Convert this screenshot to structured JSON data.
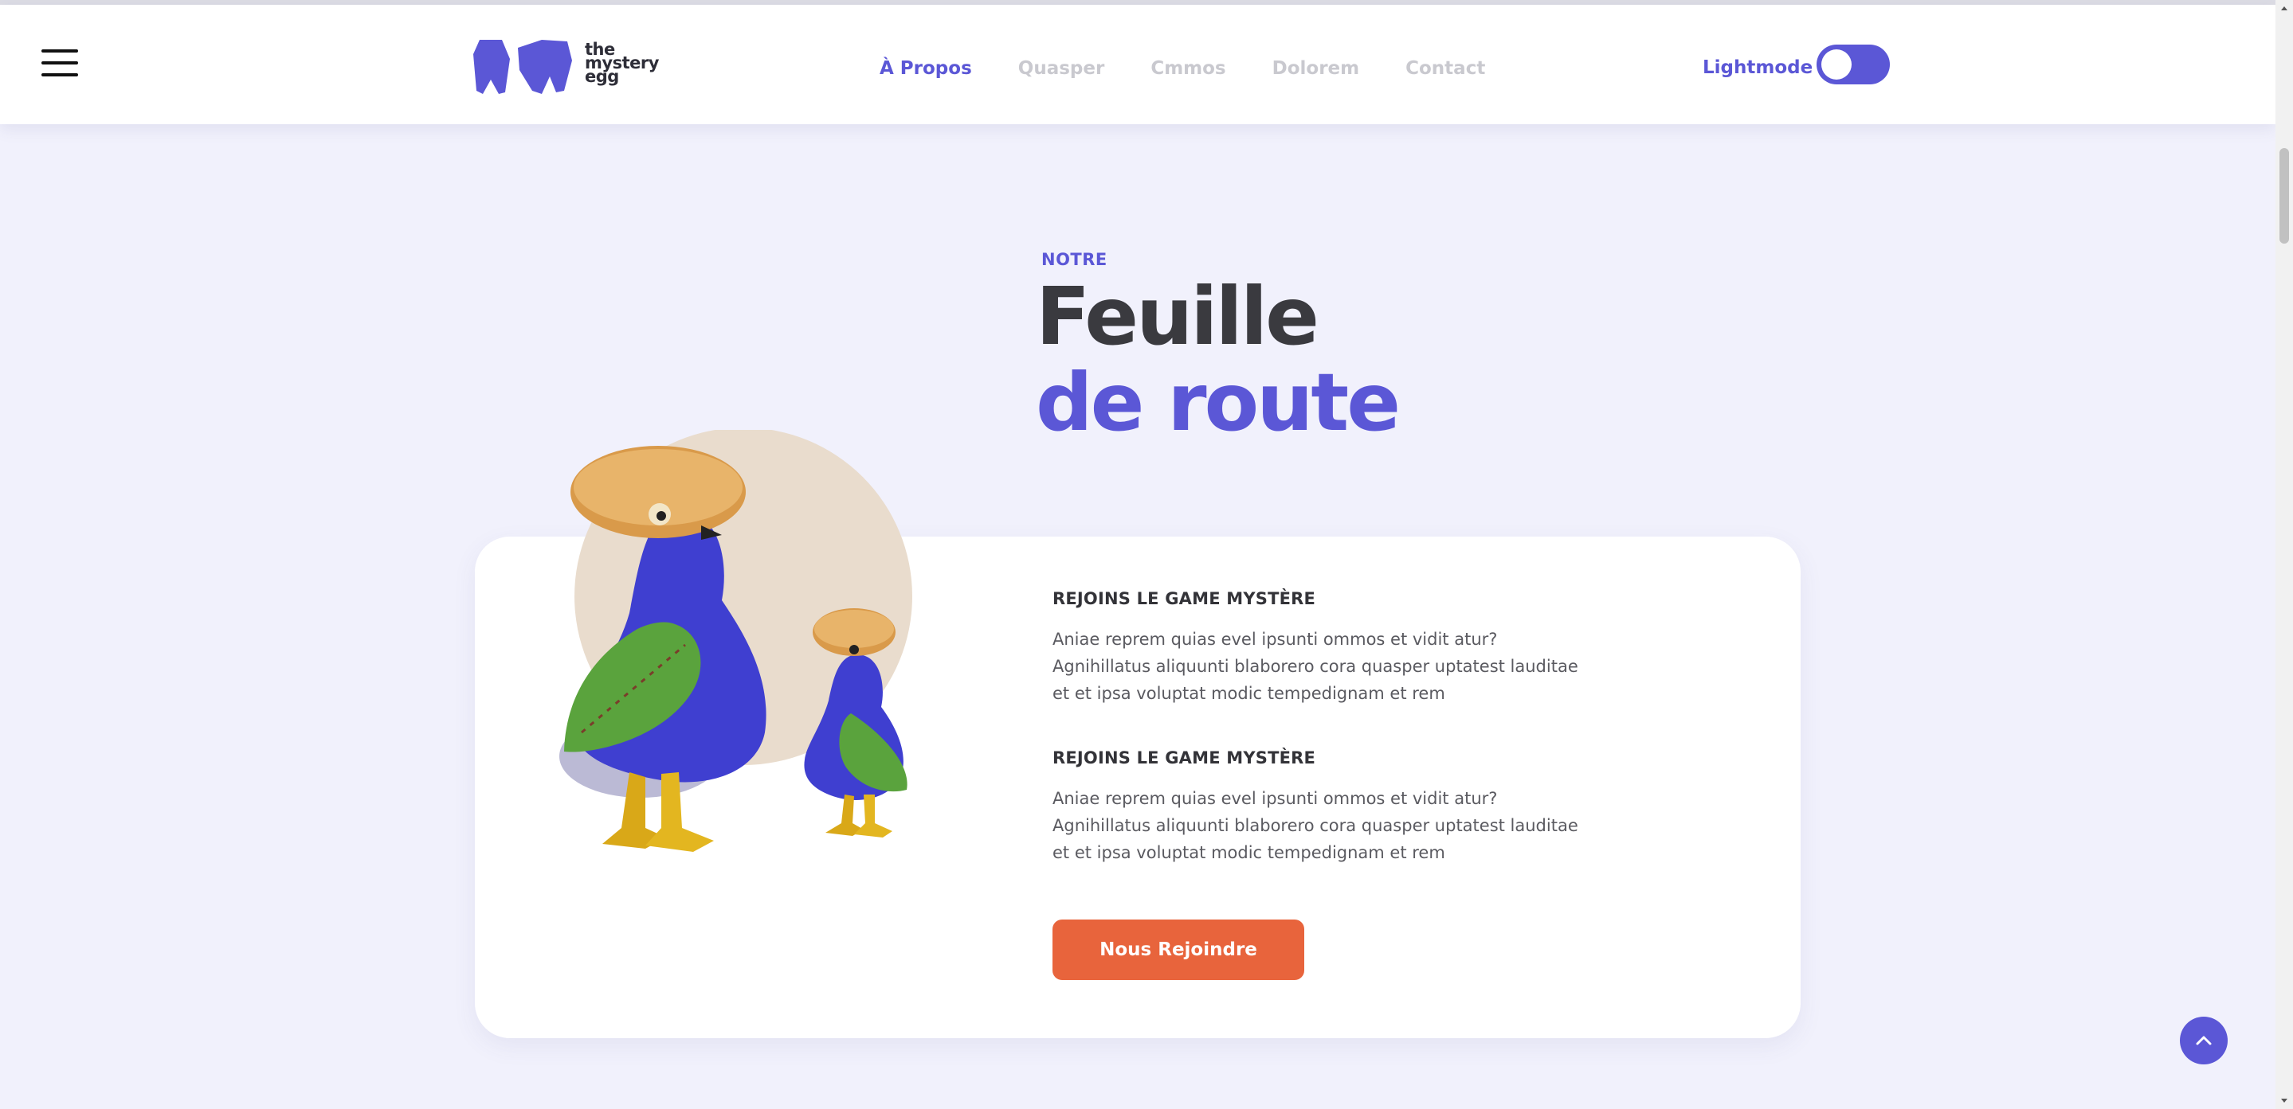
{
  "brand": {
    "logo_lines": [
      "the",
      "mystery",
      "egg"
    ]
  },
  "nav": {
    "items": [
      {
        "label": "À Propos",
        "active": true
      },
      {
        "label": "Quasper",
        "active": false
      },
      {
        "label": "Cmmos",
        "active": false
      },
      {
        "label": "Dolorem",
        "active": false
      },
      {
        "label": "Contact",
        "active": false
      }
    ]
  },
  "theme_toggle": {
    "label": "Lightmode"
  },
  "section": {
    "kicker": "NOTRE",
    "title_line1": "Feuille",
    "title_line2": "de route"
  },
  "card": {
    "blocks": [
      {
        "heading": "REJOINS LE GAME MYSTÈRE",
        "body": "Aniae reprem quias evel ipsunti ommos et vidit atur? Agnihillatus aliquunti blaborero cora quasper uptatest lauditae et et ipsa voluptat modic tempedignam et rem"
      },
      {
        "heading": "REJOINS LE GAME MYSTÈRE",
        "body": "Aniae reprem quias evel ipsunti ommos et vidit atur? Agnihillatus aliquunti blaborero cora quasper uptatest lauditae et et ipsa voluptat modic tempedignam et rem"
      }
    ],
    "cta_label": "Nous Rejoindre"
  },
  "icons": {
    "menu": "hamburger-menu-icon",
    "scroll_top": "chevron-up-icon"
  },
  "colors": {
    "accent": "#5b57d6",
    "cta": "#e8643c",
    "page_bg": "#f1f1fc",
    "heading_dark": "#3a3a3f"
  }
}
